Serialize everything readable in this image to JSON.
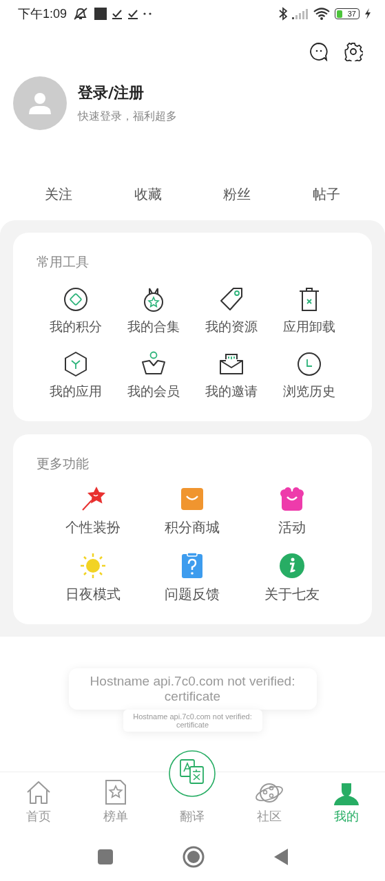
{
  "status_bar": {
    "time": "下午1:09",
    "battery": "37"
  },
  "profile": {
    "title": "登录/注册",
    "subtitle": "快速登录，福利超多"
  },
  "stats": [
    "关注",
    "收藏",
    "粉丝",
    "帖子"
  ],
  "tools": {
    "title": "常用工具",
    "items": [
      "我的积分",
      "我的合集",
      "我的资源",
      "应用卸载",
      "我的应用",
      "我的会员",
      "我的邀请",
      "浏览历史"
    ]
  },
  "more": {
    "title": "更多功能",
    "items": [
      {
        "label": "个性装扮",
        "color": "#e8302f"
      },
      {
        "label": "积分商城",
        "color": "#f0952f"
      },
      {
        "label": "活动",
        "color": "#ee3bab"
      },
      {
        "label": "日夜模式",
        "color": "#f2d324"
      },
      {
        "label": "问题反馈",
        "color": "#3d9cee"
      },
      {
        "label": "关于七友",
        "color": "#27ad64"
      }
    ]
  },
  "toasts": [
    "Hostname api.7c0.com not verified: certificate",
    "Hostname api.7c0.com not verified: certificate"
  ],
  "bottom_nav": [
    {
      "label": "首页",
      "selected": false
    },
    {
      "label": "榜单",
      "selected": false
    },
    {
      "label": "翻译",
      "selected": false
    },
    {
      "label": "社区",
      "selected": false
    },
    {
      "label": "我的",
      "selected": true
    }
  ]
}
